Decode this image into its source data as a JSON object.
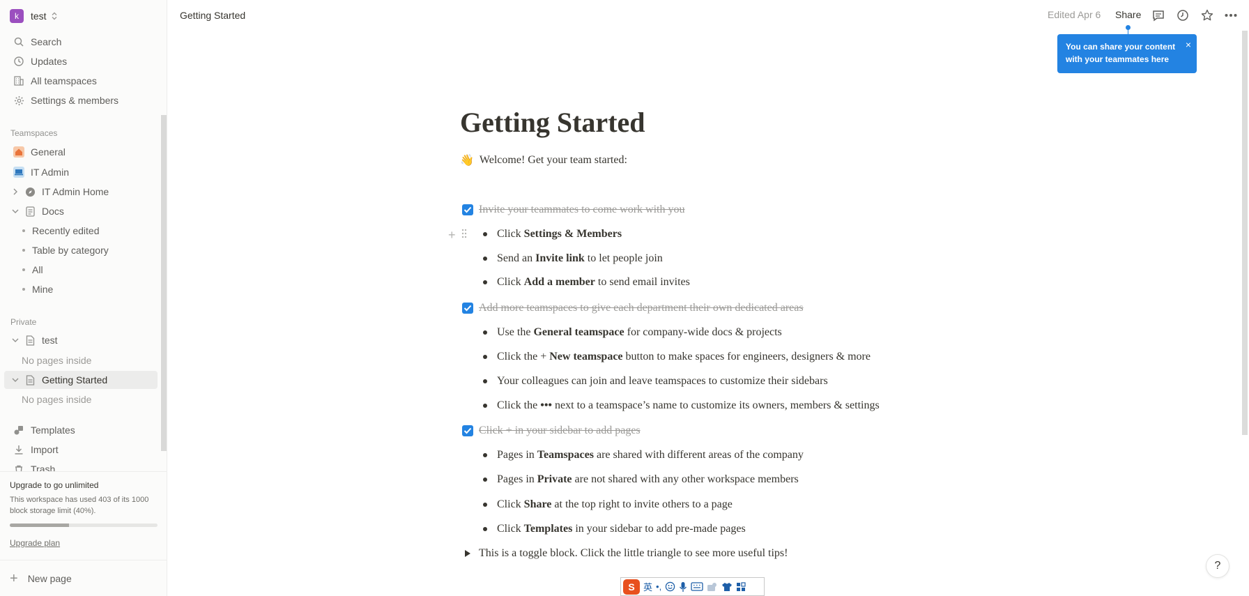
{
  "workspace": {
    "avatar": "k",
    "name": "test"
  },
  "sidebar": {
    "nav": [
      {
        "label": "Search",
        "icon": "search-icon"
      },
      {
        "label": "Updates",
        "icon": "clock-icon"
      },
      {
        "label": "All teamspaces",
        "icon": "building-icon"
      },
      {
        "label": "Settings & members",
        "icon": "gear-icon"
      }
    ],
    "teamspaces_label": "Teamspaces",
    "teamspaces": [
      {
        "label": "General",
        "icon": "house-icon"
      },
      {
        "label": "IT Admin",
        "icon": "laptop-icon"
      },
      {
        "label": "IT Admin Home",
        "icon": "compass-icon"
      },
      {
        "label": "Docs",
        "icon": "document-icon"
      }
    ],
    "docs_children": [
      "Recently edited",
      "Table by category",
      "All",
      "Mine"
    ],
    "private_label": "Private",
    "private": [
      {
        "label": "test",
        "empty": "No pages inside"
      },
      {
        "label": "Getting Started",
        "empty": "No pages inside"
      }
    ],
    "bottom": [
      {
        "label": "Templates",
        "icon": "shapes-icon"
      },
      {
        "label": "Import",
        "icon": "download-icon"
      },
      {
        "label": "Trash",
        "icon": "trash-icon"
      }
    ],
    "upgrade": {
      "title": "Upgrade to go unlimited",
      "description": "This workspace has used 403 of its 1000 block storage limit (40%).",
      "progress": 0.403,
      "link": "Upgrade plan"
    },
    "new_page": "New page"
  },
  "topbar": {
    "breadcrumb": "Getting Started",
    "edited": "Edited Apr 6",
    "share": "Share"
  },
  "tooltip": {
    "text": "You can share your content with your teammates here",
    "close": "×"
  },
  "page": {
    "title": "Getting Started",
    "welcome_emoji": "👋",
    "welcome": "Welcome! Get your team started:",
    "sections": [
      {
        "todo": "Invite your teammates to come work with you",
        "bullets": [
          {
            "pre": "Click ",
            "bold": "Settings & Members",
            "post": ""
          },
          {
            "pre": "Send an ",
            "bold": "Invite link",
            "post": " to let people join"
          },
          {
            "pre": "Click ",
            "bold": "Add a member",
            "post": " to send email invites"
          }
        ]
      },
      {
        "todo": "Add more teamspaces to give each department their own dedicated areas",
        "bullets": [
          {
            "pre": "Use the ",
            "bold": "General teamspace",
            "post": " for company-wide docs & projects"
          },
          {
            "pre": "Click the + ",
            "bold": "New teamspace",
            "post": " button to make spaces for engineers, designers & more"
          },
          {
            "pre": "Your colleagues can join and leave teamspaces to customize their sidebars",
            "bold": "",
            "post": ""
          },
          {
            "pre": "Click the ",
            "bold": "•••",
            "post": " next to a teamspace’s name to customize its owners, members & settings"
          }
        ]
      },
      {
        "todo": "Click + in your sidebar to add pages",
        "bullets": [
          {
            "pre": "Pages in ",
            "bold": "Teamspaces",
            "post": " are shared with different areas of the company"
          },
          {
            "pre": "Pages in ",
            "bold": "Private",
            "post": " are not shared with any other workspace members"
          },
          {
            "pre": "Click ",
            "bold": "Share",
            "post": " at the top right to invite others to a page"
          },
          {
            "pre": "Click ",
            "bold": "Templates",
            "post": " in your sidebar to add pre-made pages"
          }
        ]
      }
    ],
    "toggle": "This is a toggle block. Click the little triangle to see more useful tips!"
  },
  "ime": {
    "mode": "英",
    "punct": "•,",
    "logo": "S"
  },
  "help": "?",
  "colors": {
    "accent": "#2383e2",
    "text": "#37352f",
    "muted": "#9b9a97",
    "sidebar_bg": "#fbfbfa"
  }
}
